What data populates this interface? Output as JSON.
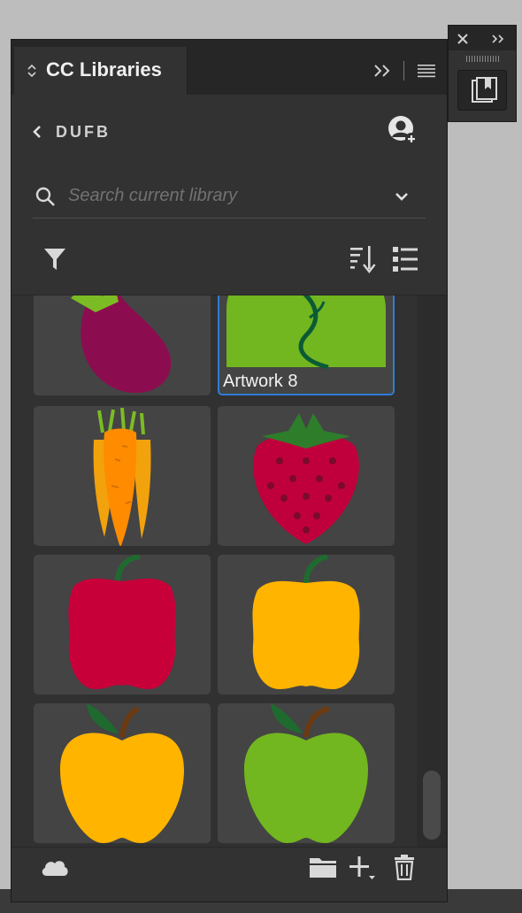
{
  "panel": {
    "tab_title": "CC Libraries",
    "library_name": "DUFB",
    "search": {
      "placeholder": "Search current library",
      "value": ""
    }
  },
  "tiles": [
    {
      "name": "Eggplant",
      "label": ""
    },
    {
      "name": "Apple",
      "label": "Artwork 8",
      "selected": true
    },
    {
      "name": "Carrots",
      "label": ""
    },
    {
      "name": "Strawberry",
      "label": ""
    },
    {
      "name": "Red pepper",
      "label": ""
    },
    {
      "name": "Yellow pepper",
      "label": ""
    },
    {
      "name": "Yellow apple",
      "label": ""
    },
    {
      "name": "Green apple",
      "label": ""
    }
  ],
  "icons": {
    "tab": [
      "updown-arrows-icon",
      "collapse-double-chevron-icon",
      "panel-menu-icon"
    ],
    "header": [
      "back-chevron-icon",
      "user-add-icon"
    ],
    "toolbar": [
      "search-icon",
      "chevron-down-icon",
      "filter-icon",
      "sort-icon",
      "list-view-icon"
    ],
    "footer": [
      "cloud-icon",
      "folder-icon",
      "add-icon",
      "trash-icon"
    ],
    "dock": [
      "close-icon",
      "expand-icon",
      "libraries-icon"
    ]
  },
  "colors": {
    "panel_bg": "#323232",
    "tile_bg": "#444444",
    "selection_outline": "#2e7dd6",
    "app_bg": "#bdbdbd"
  }
}
